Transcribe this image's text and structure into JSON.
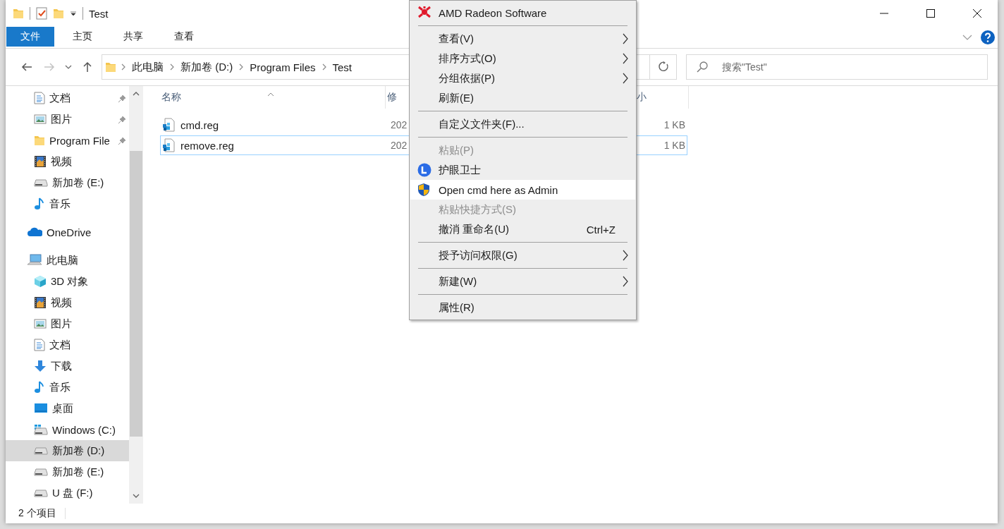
{
  "window": {
    "title": "Test"
  },
  "ribbon_tabs": [
    {
      "label": "文件",
      "selected": true
    },
    {
      "label": "主页",
      "selected": false
    },
    {
      "label": "共享",
      "selected": false
    },
    {
      "label": "查看",
      "selected": false
    }
  ],
  "address_bar": {
    "path": [
      "此电脑",
      "新加卷 (D:)",
      "Program Files",
      "Test"
    ]
  },
  "search": {
    "placeholder": "搜索\"Test\""
  },
  "quick_access": [
    {
      "label": "文档",
      "kind": "document",
      "pinned": true,
      "selected": false
    },
    {
      "label": "图片",
      "kind": "picture",
      "pinned": true,
      "selected": false
    },
    {
      "label": "Program File",
      "kind": "folder",
      "pinned": true,
      "selected": false
    },
    {
      "label": "视频",
      "kind": "video",
      "pinned": false,
      "selected": false
    },
    {
      "label": "新加卷 (E:)",
      "kind": "drive",
      "pinned": false,
      "selected": false
    },
    {
      "label": "音乐",
      "kind": "music",
      "pinned": false,
      "selected": false
    }
  ],
  "tree": [
    {
      "label": "OneDrive",
      "kind": "cloud",
      "selected": false
    },
    {
      "label": "此电脑",
      "kind": "pc",
      "selected": false,
      "children": [
        {
          "label": "3D 对象",
          "kind": "cube",
          "selected": false
        },
        {
          "label": "视频",
          "kind": "video",
          "selected": false
        },
        {
          "label": "图片",
          "kind": "picture",
          "selected": false
        },
        {
          "label": "文档",
          "kind": "document",
          "selected": false
        },
        {
          "label": "下载",
          "kind": "download",
          "selected": false
        },
        {
          "label": "音乐",
          "kind": "music",
          "selected": false
        },
        {
          "label": "桌面",
          "kind": "desktop",
          "selected": false
        },
        {
          "label": "Windows (C:)",
          "kind": "windows",
          "selected": false
        },
        {
          "label": "新加卷 (D:)",
          "kind": "drive",
          "selected": true
        },
        {
          "label": "新加卷 (E:)",
          "kind": "drive",
          "selected": false
        },
        {
          "label": "U 盘 (F:)",
          "kind": "drive",
          "selected": false
        }
      ]
    }
  ],
  "file_list": {
    "columns": [
      "名称",
      "修",
      "小"
    ],
    "rows": [
      {
        "name": "cmd.reg",
        "date": "202",
        "size": "1 KB",
        "focused": false
      },
      {
        "name": "remove.reg",
        "date": "202",
        "size": "1 KB",
        "focused": true
      }
    ]
  },
  "status_bar": {
    "item_count": "2 个项目"
  },
  "context_menu": [
    {
      "kind": "amd",
      "label": "AMD Radeon Software"
    },
    {
      "kind": "separator"
    },
    {
      "kind": "item",
      "label": "查看(V)",
      "submenu": true
    },
    {
      "kind": "item",
      "label": "排序方式(O)",
      "submenu": true
    },
    {
      "kind": "item",
      "label": "分组依据(P)",
      "submenu": true
    },
    {
      "kind": "item",
      "label": "刷新(E)"
    },
    {
      "kind": "separator"
    },
    {
      "kind": "item",
      "label": "自定义文件夹(F)..."
    },
    {
      "kind": "separator"
    },
    {
      "kind": "item",
      "label": "粘贴(P)",
      "disabled": true
    },
    {
      "kind": "badge",
      "label": "护眼卫士"
    },
    {
      "kind": "shield",
      "label": "Open cmd here as Admin",
      "hovered": true
    },
    {
      "kind": "item",
      "label": "粘贴快捷方式(S)",
      "disabled": true
    },
    {
      "kind": "item",
      "label": "撤消 重命名(U)",
      "shortcut": "Ctrl+Z"
    },
    {
      "kind": "separator"
    },
    {
      "kind": "item",
      "label": "授予访问权限(G)",
      "submenu": true
    },
    {
      "kind": "separator"
    },
    {
      "kind": "item",
      "label": "新建(W)",
      "submenu": true
    },
    {
      "kind": "separator"
    },
    {
      "kind": "item",
      "label": "属性(R)"
    }
  ]
}
